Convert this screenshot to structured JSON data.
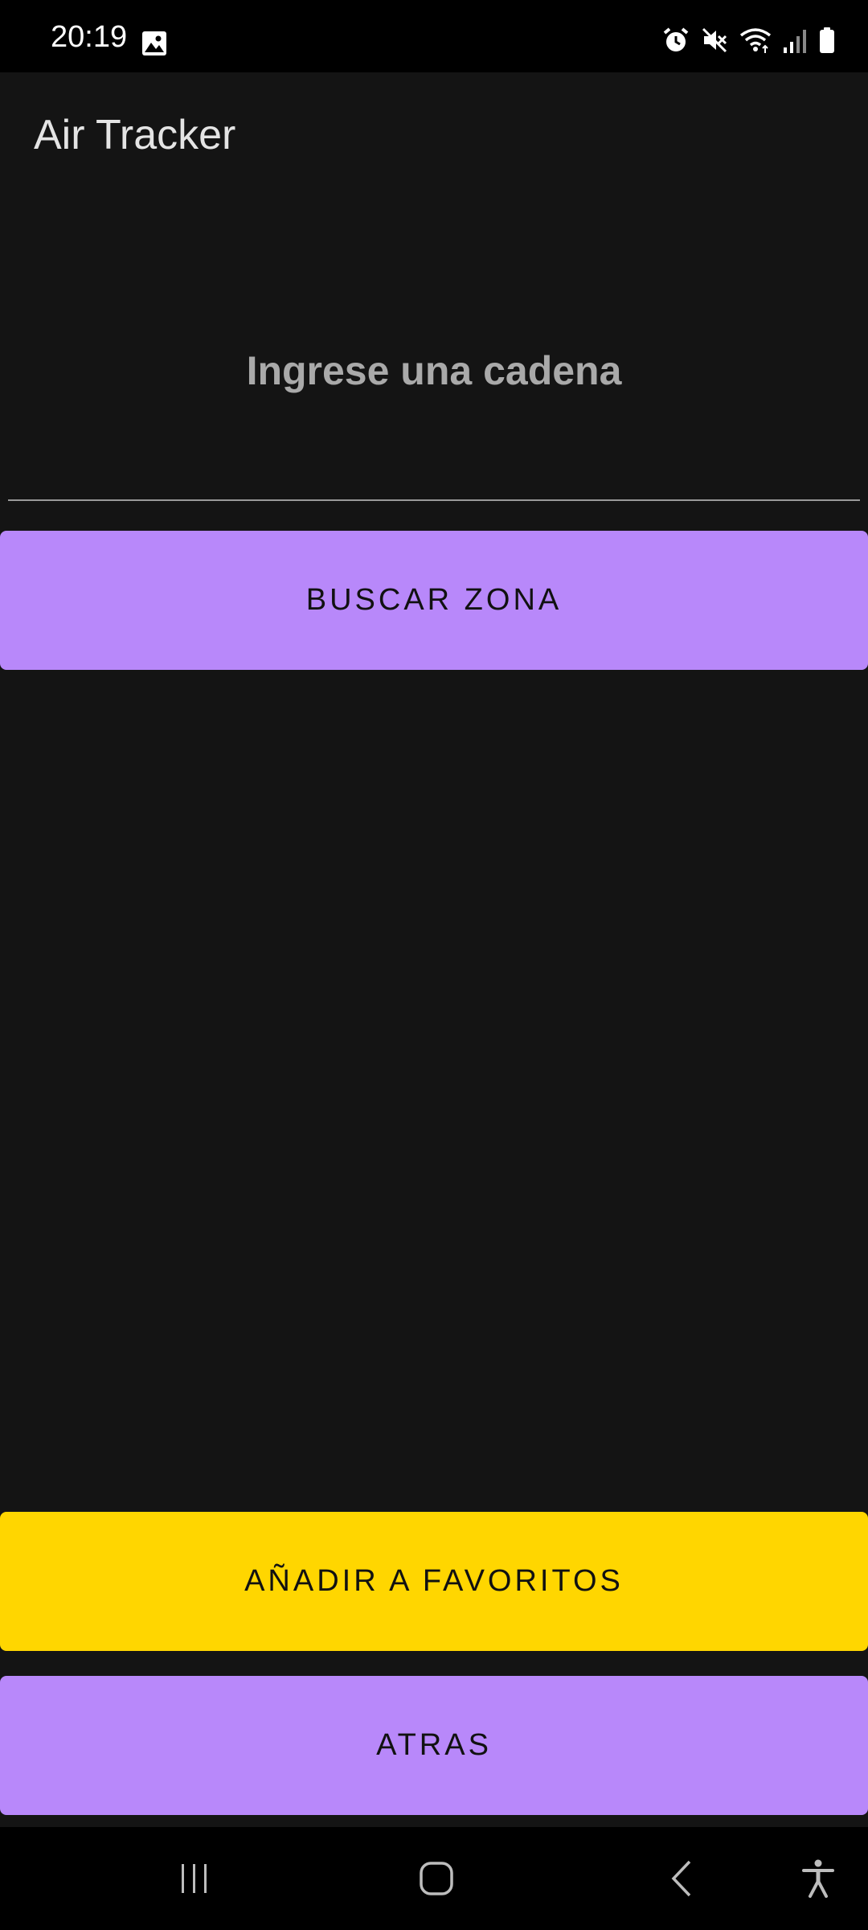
{
  "status_bar": {
    "time": "20:19",
    "icons": [
      "gallery-icon",
      "alarm-icon",
      "mute-icon",
      "wifi-icon",
      "signal-icon",
      "battery-icon"
    ]
  },
  "app_bar": {
    "title": "Air Tracker"
  },
  "search": {
    "placeholder": "Ingrese una cadena",
    "value": ""
  },
  "buttons": {
    "search_label": "BUSCAR ZONA",
    "favorites_label": "AÑADIR A FAVORITOS",
    "back_label": "ATRAS"
  },
  "colors": {
    "background": "#141414",
    "primary": "#b888fa",
    "favorites": "#ffd600"
  },
  "nav_bar": {
    "icons": [
      "recents-icon",
      "home-icon",
      "back-icon",
      "accessibility-icon"
    ]
  }
}
